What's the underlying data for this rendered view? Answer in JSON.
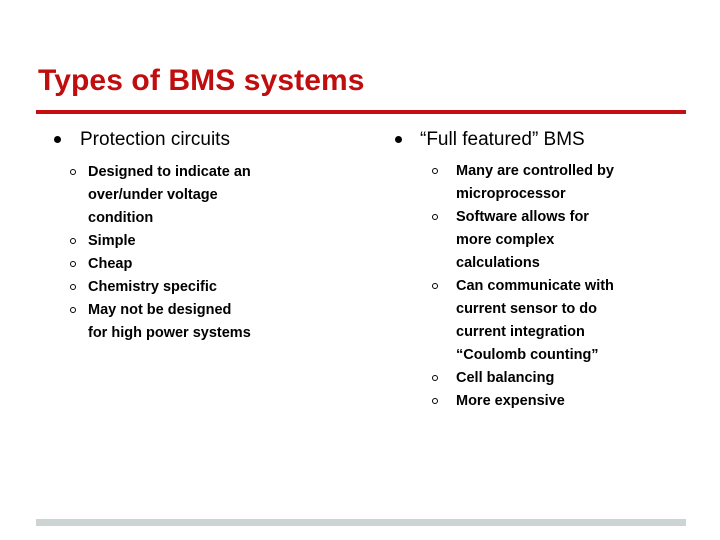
{
  "slide": {
    "title": "Types of BMS systems",
    "accent_color": "#c40e12",
    "title_color": "#c00d0d",
    "footer_bar_color": "#cdd4d4",
    "background_color": "#ffffff",
    "columns": [
      {
        "heading": "Protection circuits",
        "bullet_glyph": "filled-disc",
        "items": [
          {
            "text": "Designed to indicate an over/under voltage condition",
            "lines": [
              "Designed to indicate an",
              "over/under voltage",
              "condition"
            ]
          },
          {
            "text": "Simple",
            "lines": [
              "Simple"
            ]
          },
          {
            "text": "Cheap",
            "lines": [
              "Cheap"
            ]
          },
          {
            "text": "Chemistry specific",
            "lines": [
              "Chemistry specific"
            ]
          },
          {
            "text": "May not be designed for high power systems",
            "lines": [
              "May not be designed",
              "for high power systems"
            ]
          }
        ]
      },
      {
        "heading": "“Full featured” BMS",
        "bullet_glyph": "filled-disc",
        "items": [
          {
            "text": "Many are controlled by microprocessor",
            "lines": [
              "Many are controlled by",
              "microprocessor"
            ]
          },
          {
            "text": "Software allows for more complex calculations",
            "lines": [
              "Software allows for",
              "more complex",
              "calculations"
            ]
          },
          {
            "text": "Can communicate with current sensor to do current integration “Coulomb counting”",
            "lines": [
              "Can communicate with",
              "current sensor to do",
              "current integration",
              "“Coulomb counting”"
            ]
          },
          {
            "text": "Cell balancing",
            "lines": [
              "Cell balancing"
            ]
          },
          {
            "text": "More expensive",
            "lines": [
              "More expensive"
            ]
          }
        ]
      }
    ]
  }
}
